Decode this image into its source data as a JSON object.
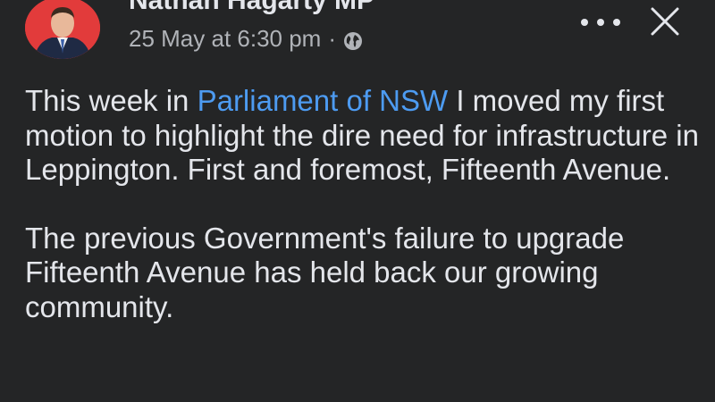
{
  "post": {
    "author": "Nathan Hagarty MP",
    "timestamp": "25 May at 6:30 pm",
    "separator": "·",
    "audience_icon": "globe-icon",
    "paragraph1": {
      "before": "This week in ",
      "link": "Parliament of NSW",
      "after": " I moved my first motion to highlight the dire need for infrastructure in Leppington. First and foremost, Fifteenth Avenue."
    },
    "paragraph2": "The previous Government's failure to upgrade Fifteenth Avenue has held back our growing community."
  },
  "actions": {
    "more_icon": "more-horizontal-icon",
    "close_icon": "close-icon"
  },
  "colors": {
    "background": "#242526",
    "text": "#e4e6eb",
    "secondary_text": "#b0b3b8",
    "link": "#4d9bf1",
    "avatar_background": "#e23b3b"
  }
}
